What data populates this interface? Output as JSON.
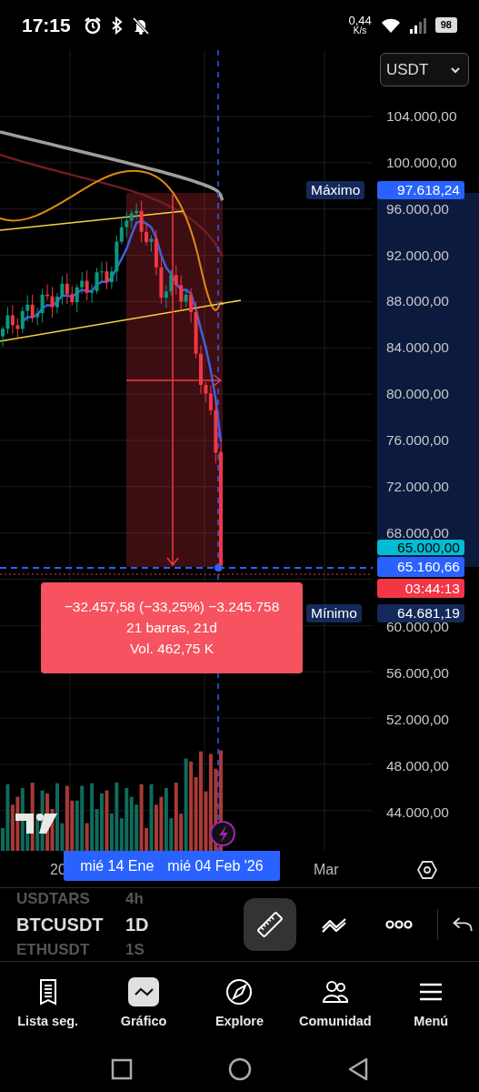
{
  "status_bar": {
    "time": "17:15",
    "net_speed": "0,44",
    "net_unit": "K/s",
    "battery": "98"
  },
  "currency_select": {
    "value": "USDT"
  },
  "price_axis": {
    "upper_labels": [
      "104.000,00",
      "100.000,00",
      "96.000,00",
      "92.000,00",
      "88.000,00",
      "84.000,00",
      "80.000,00",
      "76.000,00",
      "72.000,00",
      "68.000,00"
    ],
    "lower_labels": [
      "60.000,00",
      "56.000,00",
      "52.000,00",
      "48.000,00",
      "44.000,00"
    ]
  },
  "price_tags": {
    "maximum": {
      "label": "Máximo",
      "value": "97.618,24"
    },
    "alert": "65.000,00",
    "last_price": "65.160,66",
    "countdown": "03:44:13",
    "minimum": {
      "label": "Mínimo",
      "value": "64.681,19"
    }
  },
  "measure_box": {
    "lines": [
      "−32.457,58 (−33,25%) −3.245.758",
      "21 barras, 21d",
      "Vol. 462,75 K"
    ]
  },
  "time_axis": {
    "labels": [
      "20",
      "Mar"
    ],
    "range_tag": [
      "mié 14 Ene",
      "mié 04 Feb '26"
    ]
  },
  "watchlist": [
    {
      "symbol": "USDTARS",
      "interval": "4h",
      "selected": false
    },
    {
      "symbol": "BTCUSDT",
      "interval": "1D",
      "selected": true
    },
    {
      "symbol": "ETHUSDT",
      "interval": "1S",
      "selected": false
    }
  ],
  "tools": [
    {
      "kind": "ruler",
      "selected": true
    },
    {
      "kind": "pattern",
      "selected": false
    },
    {
      "kind": "more",
      "selected": false
    },
    {
      "kind": "undo",
      "selected": false
    }
  ],
  "bottom_nav": [
    {
      "label": "Lista seg.",
      "selected": false
    },
    {
      "label": "Gráfico",
      "selected": true
    },
    {
      "label": "Explore",
      "selected": false
    },
    {
      "label": "Comunidad",
      "selected": false
    },
    {
      "label": "Menú",
      "selected": false
    }
  ]
}
